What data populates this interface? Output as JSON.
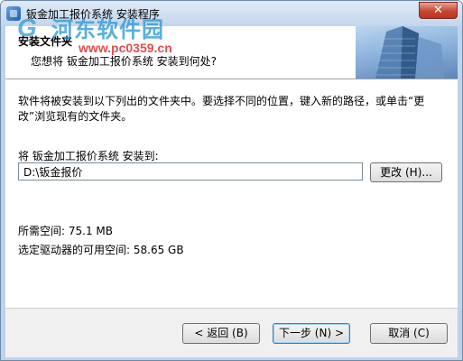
{
  "window": {
    "title": "钣金加工报价系统 安装程序",
    "close_glyph": "✕"
  },
  "watermark": {
    "logo": "G",
    "main": "河东软件园",
    "url": "www.pc0359.cn"
  },
  "header": {
    "title": "安装文件夹",
    "subtitle": "您想将 钣金加工报价系统 安装到何处?"
  },
  "body": {
    "description": "软件将被安装到以下列出的文件夹中。要选择不同的位置，键入新的路径，或单击“更改”浏览现有的文件夹。",
    "install_label": "将 钣金加工报价系统 安装到:",
    "install_path": "D:\\钣金报价",
    "change_button": "更改 (H)...",
    "space_required": "所需空间: 75.1 MB",
    "space_available": "选定驱动器的可用空间: 58.65 GB"
  },
  "footer": {
    "back_button": "< 返回 (B)",
    "next_button": "下一步 (N) >",
    "cancel_button": "取消 (C)"
  },
  "colors": {
    "accent": "#3c7fb1",
    "close_red": "#c9462f",
    "watermark_blue": "#2f9bd6",
    "watermark_red": "#e0302a"
  }
}
